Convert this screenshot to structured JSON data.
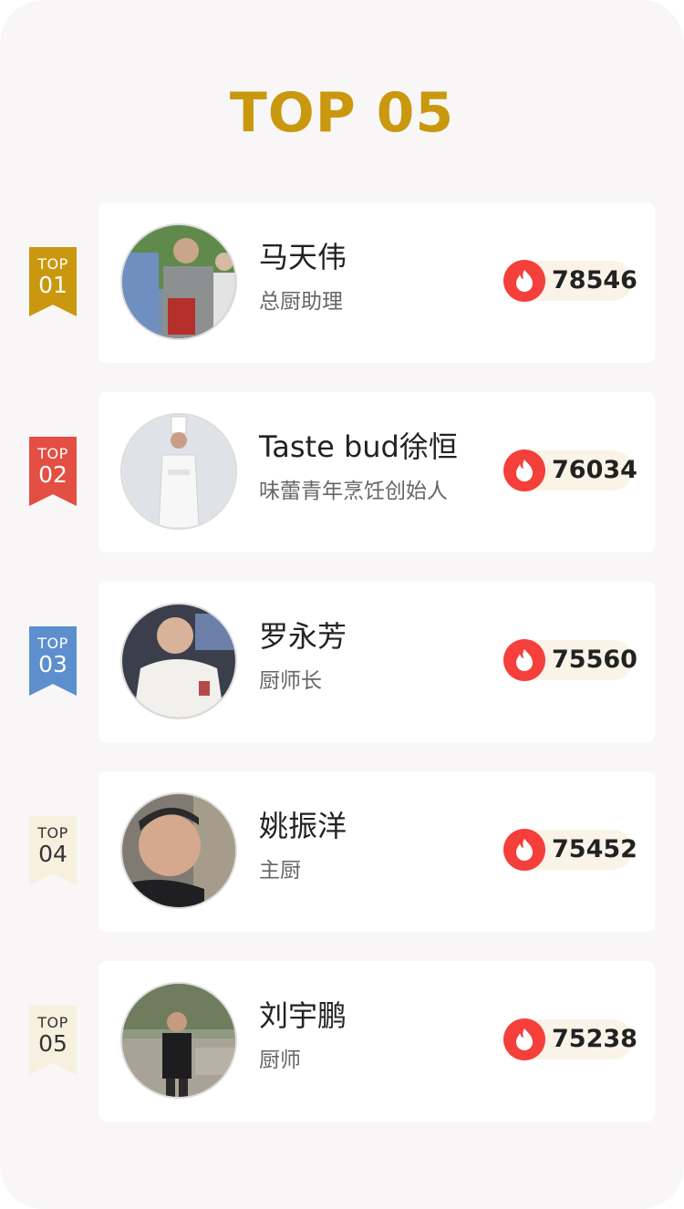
{
  "title": "TOP 05",
  "colors": {
    "title": "#c9980e",
    "fire": "#f43f3a",
    "score_pill": "#faf4e8"
  },
  "entries": [
    {
      "rank_label": "TOP",
      "rank": "01",
      "ribbon_color": "#c9980e",
      "ribbon_text_color": "#ffffff",
      "name": "马天伟",
      "role": "总厨助理",
      "score": "78546",
      "avatar_icon": "chef-photo-avatar"
    },
    {
      "rank_label": "TOP",
      "rank": "02",
      "ribbon_color": "#e34f43",
      "ribbon_text_color": "#ffffff",
      "name": "Taste bud徐恒",
      "role": "味蕾青年烹饪创始人",
      "score": "76034",
      "avatar_icon": "chef-photo-avatar"
    },
    {
      "rank_label": "TOP",
      "rank": "03",
      "ribbon_color": "#5d8fce",
      "ribbon_text_color": "#ffffff",
      "name": "罗永芳",
      "role": "厨师长",
      "score": "75560",
      "avatar_icon": "chef-photo-avatar"
    },
    {
      "rank_label": "TOP",
      "rank": "04",
      "ribbon_color": "#f7f0df",
      "ribbon_text_color": "#333333",
      "name": "姚振洋",
      "role": "主厨",
      "score": "75452",
      "avatar_icon": "chef-photo-avatar"
    },
    {
      "rank_label": "TOP",
      "rank": "05",
      "ribbon_color": "#f7f0df",
      "ribbon_text_color": "#333333",
      "name": "刘宇鹏",
      "role": "厨师",
      "score": "75238",
      "avatar_icon": "chef-photo-avatar"
    }
  ]
}
